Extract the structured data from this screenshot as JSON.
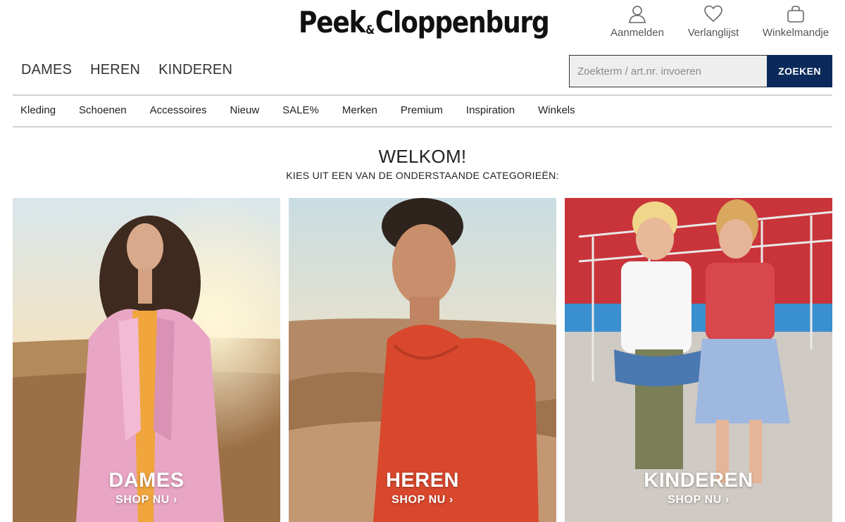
{
  "header": {
    "logo_text": "Peek&Cloppenburg",
    "logo_left": "Peek",
    "logo_amp": "&",
    "logo_right": "Cloppenburg",
    "utilities": [
      {
        "label": "Aanmelden",
        "icon": "user-icon"
      },
      {
        "label": "Verlanglijst",
        "icon": "heart-icon"
      },
      {
        "label": "Winkelmandje",
        "icon": "bag-icon"
      }
    ]
  },
  "main_nav": [
    "DAMES",
    "HEREN",
    "KINDEREN"
  ],
  "search": {
    "placeholder": "Zoekterm / art.nr. invoeren",
    "value": "",
    "button_label": "ZOEKEN"
  },
  "sub_nav": [
    "Kleding",
    "Schoenen",
    "Accessoires",
    "Nieuw",
    "SALE%",
    "Merken",
    "Premium",
    "Inspiration",
    "Winkels"
  ],
  "welcome": {
    "title": "WELKOM!",
    "subtitle": "KIES UIT EEN VAN DE ONDERSTAANDE CATEGORIEËN:"
  },
  "categories": [
    {
      "title": "DAMES",
      "link": "SHOP NU ›"
    },
    {
      "title": "HEREN",
      "link": "SHOP NU ›"
    },
    {
      "title": "KINDEREN",
      "link": "SHOP NU ›"
    }
  ],
  "colors": {
    "search_button": "#0b2a5b",
    "divider": "#cfcfcf",
    "text": "#222222",
    "utility_text": "#555555"
  }
}
